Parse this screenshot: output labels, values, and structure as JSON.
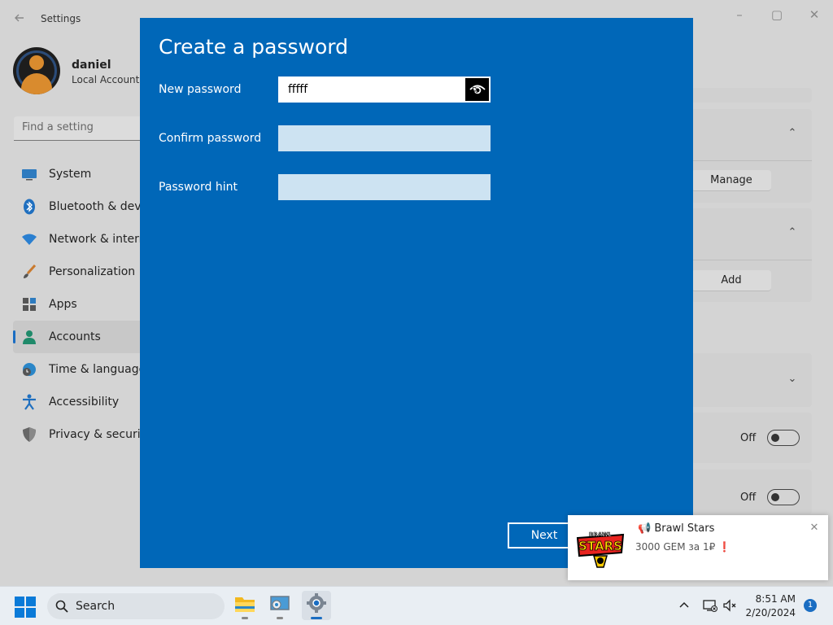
{
  "settings": {
    "app_title": "Settings",
    "back_icon": "arrow-left-icon",
    "window_controls": {
      "minimize": "–",
      "maximize": "▢",
      "close": "✕"
    },
    "user": {
      "name": "daniel",
      "account_type": "Local Account"
    },
    "search": {
      "placeholder": "Find a setting"
    },
    "nav": [
      {
        "label": "System",
        "icon": "monitor-icon",
        "active": false
      },
      {
        "label": "Bluetooth & devic",
        "icon": "bluetooth-icon",
        "active": false
      },
      {
        "label": "Network & interne",
        "icon": "wifi-icon",
        "active": false
      },
      {
        "label": "Personalization",
        "icon": "brush-icon",
        "active": false
      },
      {
        "label": "Apps",
        "icon": "apps-icon",
        "active": false
      },
      {
        "label": "Accounts",
        "icon": "person-icon",
        "active": true
      },
      {
        "label": "Time & language",
        "icon": "globe-clock-icon",
        "active": false
      },
      {
        "label": "Accessibility",
        "icon": "accessibility-icon",
        "active": false
      },
      {
        "label": "Privacy & security",
        "icon": "shield-icon",
        "active": false
      }
    ],
    "right": {
      "manage_label": "Manage",
      "add_label": "Add",
      "toggle1_label": "Off",
      "toggle2_label": "Off"
    }
  },
  "dialog": {
    "title": "Create a password",
    "new_password": {
      "label": "New password",
      "value": "fffff"
    },
    "confirm_password": {
      "label": "Confirm password",
      "value": ""
    },
    "password_hint": {
      "label": "Password hint",
      "value": ""
    },
    "next_label": "Next",
    "accent": "#0067b8"
  },
  "toast": {
    "app": "Brawl Stars",
    "title": "📢 Brawl Stars",
    "body": "3000 GEM за 1₽ ❗",
    "close": "✕",
    "logo_text_top": "BRAWL",
    "logo_text_main": "STARS"
  },
  "taskbar": {
    "search_label": "Search",
    "time": "8:51 AM",
    "date": "2/20/2024",
    "notification_count": "1",
    "apps": [
      "file-explorer-icon",
      "control-panel-icon",
      "settings-gear-icon"
    ]
  }
}
